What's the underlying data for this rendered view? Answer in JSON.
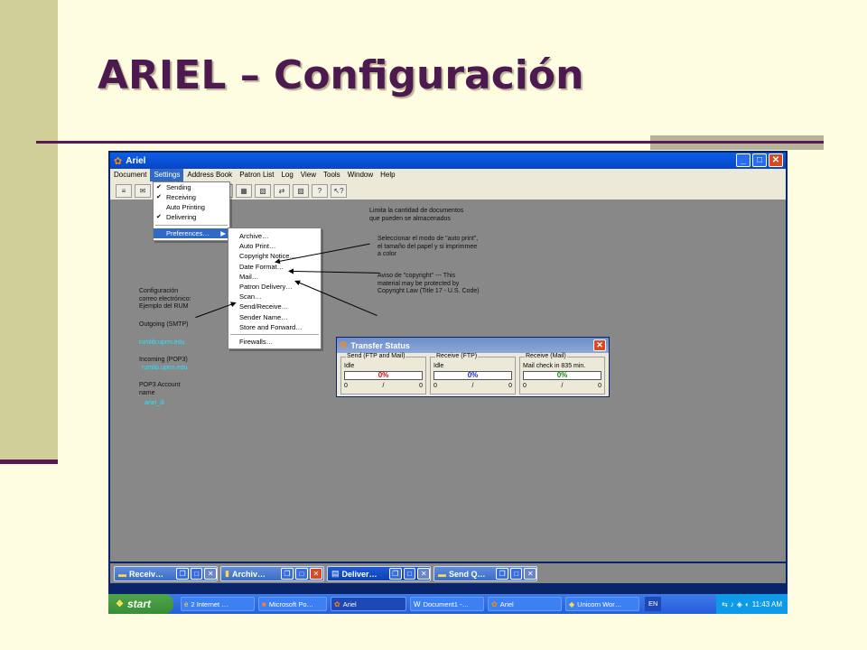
{
  "slide": {
    "title": "ARIEL – Configuración"
  },
  "window": {
    "title": "Ariel",
    "app_icon": "ariel-icon",
    "controls": [
      "minimize",
      "maximize",
      "close"
    ]
  },
  "menubar": [
    "Document",
    "Settings",
    "Address Book",
    "Patron List",
    "Log",
    "View",
    "Tools",
    "Window",
    "Help"
  ],
  "settings_menu": {
    "items": [
      {
        "label": "Sending",
        "checked": true
      },
      {
        "label": "Receiving",
        "checked": true
      },
      {
        "label": "Auto Printing",
        "checked": false
      },
      {
        "label": "Delivering",
        "checked": true
      }
    ],
    "preferences_label": "Preferences…",
    "submenu_arrow": "▶"
  },
  "preferences_menu": {
    "group1": [
      "Archive…",
      "Auto Print…",
      "Copyright Notice…",
      "Date Format…",
      "Mail…",
      "Patron Delivery…",
      "Scan…",
      "Send/Receive…",
      "Sender Name…",
      "Store and Forward…"
    ],
    "group2": [
      "Firewalls…"
    ]
  },
  "annotations": {
    "archive": [
      "Limita la cantidad  de documentos",
      "que pueden  se almacenados"
    ],
    "autoprint": [
      "Seleccionar  el modo de \"auto  print\",",
      "el tamaño  del papel  y si imprimmee",
      "a color"
    ],
    "copyright": [
      "Aviso de \"copyright\"  ---   This",
      "material  may be protected  by",
      "Copyright Law  (Title 17 - U.S. Code)"
    ],
    "mail": [
      "Configuración",
      "correo electrónico:",
      "Ejemplo del RUM"
    ],
    "smtp_label": "Outgoing  (SMTP)",
    "smtp_value": "rumlib.uprm.edu",
    "pop3_label": "Incoming  (POP3)",
    "pop3_value": "rumlib.uprm.edu",
    "account_label": [
      "POP3 Account",
      "name"
    ],
    "account_value": "ariel_ill"
  },
  "transfer_status": {
    "title": "Transfer Status",
    "groups": [
      {
        "label": "Send (FTP and Mail)",
        "status": "Idle",
        "percent": "0%",
        "percent_color": "#e00000",
        "count_left": "0",
        "count_sep": "/",
        "count_right": "0"
      },
      {
        "label": "Receive (FTP)",
        "status": "Idle",
        "percent": "0%",
        "percent_color": "#1028c8",
        "count_left": "0",
        "count_sep": "/",
        "count_right": "0"
      },
      {
        "label": "Receive (Mail)",
        "status": "Mail check in 835 min.",
        "percent": "0%",
        "percent_color": "#0a8a0a",
        "count_left": "0",
        "count_sep": "/",
        "count_right": "0"
      }
    ]
  },
  "mdi_windows": [
    {
      "label": "Receiv…",
      "active": false
    },
    {
      "label": "Archiv…",
      "active": false
    },
    {
      "label": "Deliver…",
      "active": true
    },
    {
      "label": "Send Q…",
      "active": false
    }
  ],
  "taskbar": {
    "start_label": "start",
    "tasks": [
      {
        "label": "2 Internet …",
        "icon": "ie-icon",
        "pressed": false
      },
      {
        "label": "Microsoft Po…",
        "icon": "powerpoint-icon",
        "pressed": false
      },
      {
        "label": "Ariel",
        "icon": "ariel-icon",
        "pressed": true
      },
      {
        "label": "Document1 -…",
        "icon": "word-icon",
        "pressed": false
      },
      {
        "label": "Ariel",
        "icon": "ariel-icon",
        "pressed": false
      },
      {
        "label": "Unicorn Wor…",
        "icon": "unicorn-icon",
        "pressed": false
      }
    ],
    "language": "EN",
    "clock": "11:43 AM"
  }
}
